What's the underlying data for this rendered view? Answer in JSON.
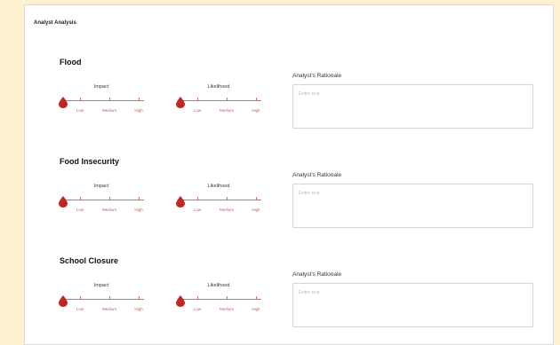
{
  "panel": {
    "title": "Analyst Analysis"
  },
  "sections": [
    {
      "title": "Flood",
      "impact_label": "Impact",
      "likelihood_label": "Likelihood",
      "rationale_label": "Analyst's Rationale",
      "rationale_placeholder": "Enter text",
      "impact_value": "Low",
      "likelihood_value": "Low"
    },
    {
      "title": "Food Insecurity",
      "impact_label": "Impact",
      "likelihood_label": "Likelihood",
      "rationale_label": "Analyst's Rationale",
      "rationale_placeholder": "Enter text",
      "impact_value": "Low",
      "likelihood_value": "Low"
    },
    {
      "title": "School Closure",
      "impact_label": "Impact",
      "likelihood_label": "Likelihood",
      "rationale_label": "Analyst's Rationale",
      "rationale_placeholder": "Enter text",
      "impact_value": "Low",
      "likelihood_value": "Low"
    }
  ],
  "scale": {
    "low": "Low",
    "medium": "Medium",
    "high": "High"
  },
  "colors": {
    "accent": "#d9534f",
    "handle": "#c1271f",
    "background": "#fdf1cf"
  },
  "icons": {
    "handle": "drop-handle-icon"
  }
}
